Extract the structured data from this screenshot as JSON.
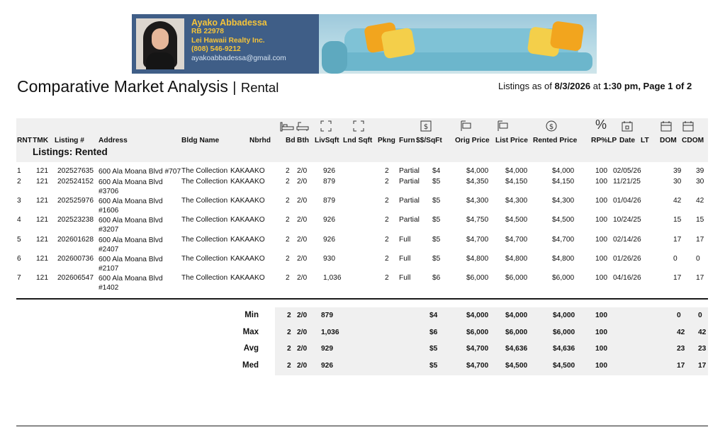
{
  "agent": {
    "name": "Ayako Abbadessa",
    "license": "RB 22978",
    "brokerage": "Lei Hawaii Realty Inc.",
    "phone": "(808) 546-9212",
    "email": "ayakoabbadessa@gmail.com"
  },
  "title": {
    "main": "Comparative Market Analysis",
    "sep": "|",
    "sub": "Rental"
  },
  "asof": {
    "prefix": "Listings as of ",
    "date": "8/3/2026",
    "at": " at ",
    "time_page": "1:30 pm, Page 1 of 2"
  },
  "columns": {
    "rnt": "RNT",
    "tmk": "TMK",
    "listing": "Listing #",
    "address": "Address",
    "bldg": "Bldg Name",
    "nbrhd": "Nbrhd",
    "bd": "Bd",
    "bth": "Bth",
    "livsqft": "LivSqft",
    "lndsqft": "Lnd Sqft",
    "pkng": "Pkng",
    "furn": "Furn",
    "pps": "$$/SqFt",
    "orig": "Orig Price",
    "list": "List Price",
    "rented": "Rented Price",
    "rplp": "RP%LP",
    "date": "Date",
    "lt": "LT",
    "dom": "DOM",
    "cdom": "CDOM"
  },
  "header_icons": {
    "bed": "bed-icon",
    "bath": "bath-icon",
    "livsqft": "living-area-icon",
    "lndsqft": "land-area-icon",
    "pps": "price-per-sqft-icon",
    "orig": "orig-price-icon",
    "list": "list-price-icon",
    "rented": "rented-price-icon",
    "percent": "%",
    "date": "calendar-icon",
    "dom": "calendar-icon",
    "cdom": "calendar-icon"
  },
  "section": "Listings: Rented",
  "rows": [
    {
      "n": "1",
      "tmk": "121",
      "listing": "202527635",
      "addr": "600 Ala Moana Blvd #707",
      "bldg": "The Collection",
      "nbrhd": "KAKAAKO",
      "bd": "2",
      "bth": "2/0",
      "liv": "926",
      "pk": "2",
      "furn": "Partial",
      "pps": "$4",
      "orig": "$4,000",
      "list": "$4,000",
      "rented": "$4,000",
      "rplp": "100",
      "date": "02/05/26",
      "dom": "39",
      "cdom": "39"
    },
    {
      "n": "2",
      "tmk": "121",
      "listing": "202524152",
      "addr": "600 Ala Moana Blvd #3706",
      "bldg": "The Collection",
      "nbrhd": "KAKAAKO",
      "bd": "2",
      "bth": "2/0",
      "liv": "879",
      "pk": "2",
      "furn": "Partial",
      "pps": "$5",
      "orig": "$4,350",
      "list": "$4,150",
      "rented": "$4,150",
      "rplp": "100",
      "date": "11/21/25",
      "dom": "30",
      "cdom": "30"
    },
    {
      "n": "3",
      "tmk": "121",
      "listing": "202525976",
      "addr": "600 Ala Moana Blvd #1606",
      "bldg": "The Collection",
      "nbrhd": "KAKAAKO",
      "bd": "2",
      "bth": "2/0",
      "liv": "879",
      "pk": "2",
      "furn": "Partial",
      "pps": "$5",
      "orig": "$4,300",
      "list": "$4,300",
      "rented": "$4,300",
      "rplp": "100",
      "date": "01/04/26",
      "dom": "42",
      "cdom": "42"
    },
    {
      "n": "4",
      "tmk": "121",
      "listing": "202523238",
      "addr": "600 Ala Moana Blvd #3207",
      "bldg": "The Collection",
      "nbrhd": "KAKAAKO",
      "bd": "2",
      "bth": "2/0",
      "liv": "926",
      "pk": "2",
      "furn": "Partial",
      "pps": "$5",
      "orig": "$4,750",
      "list": "$4,500",
      "rented": "$4,500",
      "rplp": "100",
      "date": "10/24/25",
      "dom": "15",
      "cdom": "15"
    },
    {
      "n": "5",
      "tmk": "121",
      "listing": "202601628",
      "addr": "600 Ala Moana Blvd #2407",
      "bldg": "The Collection",
      "nbrhd": "KAKAAKO",
      "bd": "2",
      "bth": "2/0",
      "liv": "926",
      "pk": "2",
      "furn": "Full",
      "pps": "$5",
      "orig": "$4,700",
      "list": "$4,700",
      "rented": "$4,700",
      "rplp": "100",
      "date": "02/14/26",
      "dom": "17",
      "cdom": "17"
    },
    {
      "n": "6",
      "tmk": "121",
      "listing": "202600736",
      "addr": "600 Ala Moana Blvd #2107",
      "bldg": "The Collection",
      "nbrhd": "KAKAAKO",
      "bd": "2",
      "bth": "2/0",
      "liv": "930",
      "pk": "2",
      "furn": "Full",
      "pps": "$5",
      "orig": "$4,800",
      "list": "$4,800",
      "rented": "$4,800",
      "rplp": "100",
      "date": "01/26/26",
      "dom": "0",
      "cdom": "0"
    },
    {
      "n": "7",
      "tmk": "121",
      "listing": "202606547",
      "addr": "600 Ala Moana Blvd #1402",
      "bldg": "The Collection",
      "nbrhd": "KAKAAKO",
      "bd": "2",
      "bth": "2/0",
      "liv": "1,036",
      "pk": "2",
      "furn": "Full",
      "pps": "$6",
      "orig": "$6,000",
      "list": "$6,000",
      "rented": "$6,000",
      "rplp": "100",
      "date": "04/16/26",
      "dom": "17",
      "cdom": "17"
    }
  ],
  "summary": [
    {
      "label": "Min",
      "bd": "2",
      "bth": "2/0",
      "liv": "879",
      "pps": "$4",
      "orig": "$4,000",
      "list": "$4,000",
      "rented": "$4,000",
      "rplp": "100",
      "dom": "0",
      "cdom": "0"
    },
    {
      "label": "Max",
      "bd": "2",
      "bth": "2/0",
      "liv": "1,036",
      "pps": "$6",
      "orig": "$6,000",
      "list": "$6,000",
      "rented": "$6,000",
      "rplp": "100",
      "dom": "42",
      "cdom": "42"
    },
    {
      "label": "Avg",
      "bd": "2",
      "bth": "2/0",
      "liv": "929",
      "pps": "$5",
      "orig": "$4,700",
      "list": "$4,636",
      "rented": "$4,636",
      "rplp": "100",
      "dom": "23",
      "cdom": "23"
    },
    {
      "label": "Med",
      "bd": "2",
      "bth": "2/0",
      "liv": "926",
      "pps": "$5",
      "orig": "$4,700",
      "list": "$4,500",
      "rented": "$4,500",
      "rplp": "100",
      "dom": "17",
      "cdom": "17"
    }
  ]
}
